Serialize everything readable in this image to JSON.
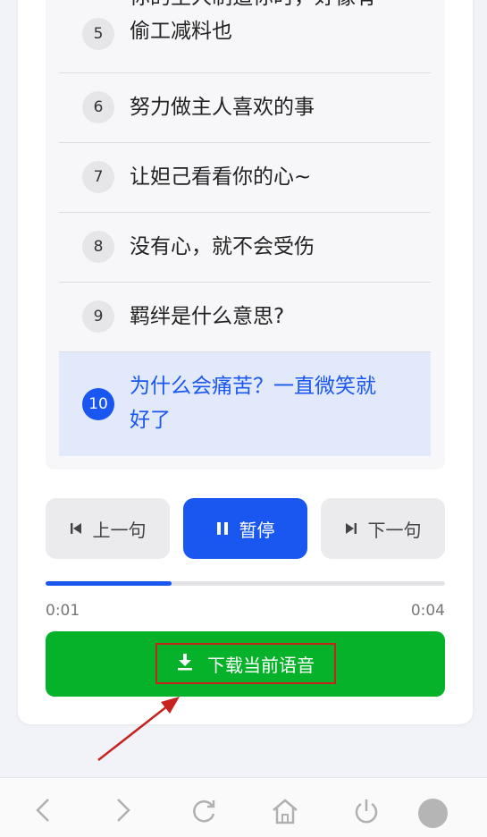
{
  "list": {
    "items": [
      {
        "num": "5",
        "lines": [
          "你的主人制造你时，好像有",
          "偷工减料也"
        ]
      },
      {
        "num": "6",
        "lines": [
          "努力做主人喜欢的事"
        ]
      },
      {
        "num": "7",
        "lines": [
          "让妲己看看你的心~"
        ]
      },
      {
        "num": "8",
        "lines": [
          "没有心，就不会受伤"
        ]
      },
      {
        "num": "9",
        "lines": [
          "羁绊是什么意思?"
        ]
      },
      {
        "num": "10",
        "lines": [
          "为什么会痛苦？一直微笑就",
          "好了"
        ]
      }
    ]
  },
  "controls": {
    "prev_label": "上一句",
    "pause_label": "暂停",
    "next_label": "下一句"
  },
  "player": {
    "current_time": "0:01",
    "total_time": "0:04",
    "progress_fraction": 0.315
  },
  "download": {
    "label": "下载当前语音"
  },
  "icons": {
    "prev": "skip-previous-icon",
    "pause": "pause-icon",
    "next": "skip-next-icon",
    "download": "download-icon",
    "nav": [
      "back-icon",
      "forward-icon",
      "refresh-icon",
      "home-icon",
      "power-icon",
      "avatar"
    ]
  },
  "colors": {
    "accent": "#1a56f0",
    "download_green": "#06b22a",
    "annotation_red": "#c8221f"
  }
}
